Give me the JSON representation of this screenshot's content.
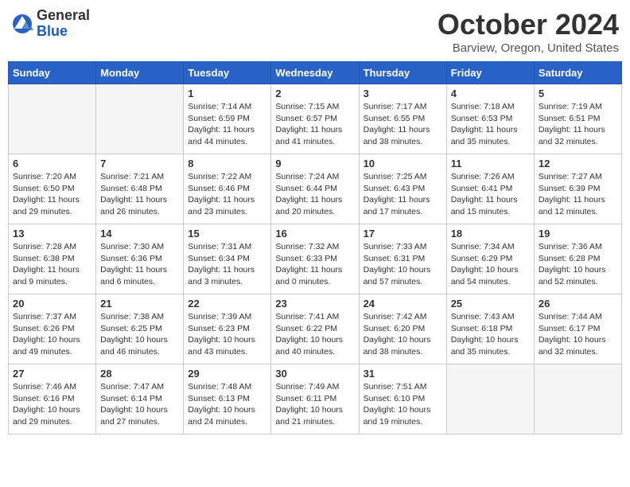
{
  "header": {
    "logo_general": "General",
    "logo_blue": "Blue",
    "month": "October 2024",
    "location": "Barview, Oregon, United States"
  },
  "days_of_week": [
    "Sunday",
    "Monday",
    "Tuesday",
    "Wednesday",
    "Thursday",
    "Friday",
    "Saturday"
  ],
  "weeks": [
    [
      {
        "num": "",
        "info": ""
      },
      {
        "num": "",
        "info": ""
      },
      {
        "num": "1",
        "info": "Sunrise: 7:14 AM\nSunset: 6:59 PM\nDaylight: 11 hours and 44 minutes."
      },
      {
        "num": "2",
        "info": "Sunrise: 7:15 AM\nSunset: 6:57 PM\nDaylight: 11 hours and 41 minutes."
      },
      {
        "num": "3",
        "info": "Sunrise: 7:17 AM\nSunset: 6:55 PM\nDaylight: 11 hours and 38 minutes."
      },
      {
        "num": "4",
        "info": "Sunrise: 7:18 AM\nSunset: 6:53 PM\nDaylight: 11 hours and 35 minutes."
      },
      {
        "num": "5",
        "info": "Sunrise: 7:19 AM\nSunset: 6:51 PM\nDaylight: 11 hours and 32 minutes."
      }
    ],
    [
      {
        "num": "6",
        "info": "Sunrise: 7:20 AM\nSunset: 6:50 PM\nDaylight: 11 hours and 29 minutes."
      },
      {
        "num": "7",
        "info": "Sunrise: 7:21 AM\nSunset: 6:48 PM\nDaylight: 11 hours and 26 minutes."
      },
      {
        "num": "8",
        "info": "Sunrise: 7:22 AM\nSunset: 6:46 PM\nDaylight: 11 hours and 23 minutes."
      },
      {
        "num": "9",
        "info": "Sunrise: 7:24 AM\nSunset: 6:44 PM\nDaylight: 11 hours and 20 minutes."
      },
      {
        "num": "10",
        "info": "Sunrise: 7:25 AM\nSunset: 6:43 PM\nDaylight: 11 hours and 17 minutes."
      },
      {
        "num": "11",
        "info": "Sunrise: 7:26 AM\nSunset: 6:41 PM\nDaylight: 11 hours and 15 minutes."
      },
      {
        "num": "12",
        "info": "Sunrise: 7:27 AM\nSunset: 6:39 PM\nDaylight: 11 hours and 12 minutes."
      }
    ],
    [
      {
        "num": "13",
        "info": "Sunrise: 7:28 AM\nSunset: 6:38 PM\nDaylight: 11 hours and 9 minutes."
      },
      {
        "num": "14",
        "info": "Sunrise: 7:30 AM\nSunset: 6:36 PM\nDaylight: 11 hours and 6 minutes."
      },
      {
        "num": "15",
        "info": "Sunrise: 7:31 AM\nSunset: 6:34 PM\nDaylight: 11 hours and 3 minutes."
      },
      {
        "num": "16",
        "info": "Sunrise: 7:32 AM\nSunset: 6:33 PM\nDaylight: 11 hours and 0 minutes."
      },
      {
        "num": "17",
        "info": "Sunrise: 7:33 AM\nSunset: 6:31 PM\nDaylight: 10 hours and 57 minutes."
      },
      {
        "num": "18",
        "info": "Sunrise: 7:34 AM\nSunset: 6:29 PM\nDaylight: 10 hours and 54 minutes."
      },
      {
        "num": "19",
        "info": "Sunrise: 7:36 AM\nSunset: 6:28 PM\nDaylight: 10 hours and 52 minutes."
      }
    ],
    [
      {
        "num": "20",
        "info": "Sunrise: 7:37 AM\nSunset: 6:26 PM\nDaylight: 10 hours and 49 minutes."
      },
      {
        "num": "21",
        "info": "Sunrise: 7:38 AM\nSunset: 6:25 PM\nDaylight: 10 hours and 46 minutes."
      },
      {
        "num": "22",
        "info": "Sunrise: 7:39 AM\nSunset: 6:23 PM\nDaylight: 10 hours and 43 minutes."
      },
      {
        "num": "23",
        "info": "Sunrise: 7:41 AM\nSunset: 6:22 PM\nDaylight: 10 hours and 40 minutes."
      },
      {
        "num": "24",
        "info": "Sunrise: 7:42 AM\nSunset: 6:20 PM\nDaylight: 10 hours and 38 minutes."
      },
      {
        "num": "25",
        "info": "Sunrise: 7:43 AM\nSunset: 6:18 PM\nDaylight: 10 hours and 35 minutes."
      },
      {
        "num": "26",
        "info": "Sunrise: 7:44 AM\nSunset: 6:17 PM\nDaylight: 10 hours and 32 minutes."
      }
    ],
    [
      {
        "num": "27",
        "info": "Sunrise: 7:46 AM\nSunset: 6:16 PM\nDaylight: 10 hours and 29 minutes."
      },
      {
        "num": "28",
        "info": "Sunrise: 7:47 AM\nSunset: 6:14 PM\nDaylight: 10 hours and 27 minutes."
      },
      {
        "num": "29",
        "info": "Sunrise: 7:48 AM\nSunset: 6:13 PM\nDaylight: 10 hours and 24 minutes."
      },
      {
        "num": "30",
        "info": "Sunrise: 7:49 AM\nSunset: 6:11 PM\nDaylight: 10 hours and 21 minutes."
      },
      {
        "num": "31",
        "info": "Sunrise: 7:51 AM\nSunset: 6:10 PM\nDaylight: 10 hours and 19 minutes."
      },
      {
        "num": "",
        "info": ""
      },
      {
        "num": "",
        "info": ""
      }
    ]
  ]
}
